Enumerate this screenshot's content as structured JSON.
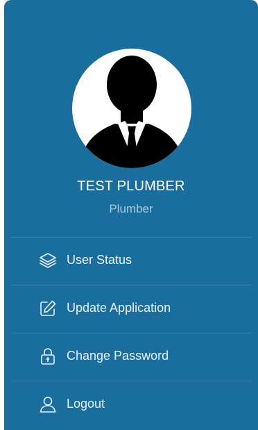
{
  "profile": {
    "name": "TEST PLUMBER",
    "role": "Plumber"
  },
  "menu": {
    "items": [
      {
        "label": "User Status",
        "icon": "layers-icon"
      },
      {
        "label": "Update Application",
        "icon": "edit-icon"
      },
      {
        "label": "Change Password",
        "icon": "lock-icon"
      },
      {
        "label": "Logout",
        "icon": "user-icon"
      }
    ]
  },
  "colors": {
    "panel_bg": "#1a6e9e",
    "name_text": "#ffffff",
    "role_text": "#a9c7db",
    "menu_text": "#e8f1f7"
  }
}
